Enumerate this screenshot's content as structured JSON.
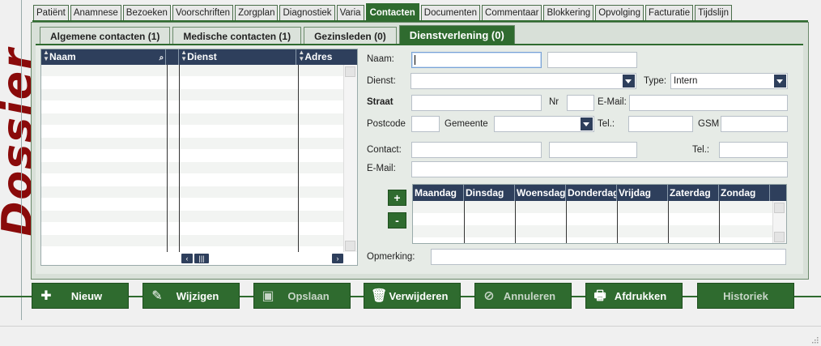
{
  "side_title": "Dossier",
  "top_tabs": [
    "Patiënt",
    "Anamnese",
    "Bezoeken",
    "Voorschriften",
    "Zorgplan",
    "Diagnostiek",
    "Varia",
    "Contacten",
    "Documenten",
    "Commentaar",
    "Blokkering",
    "Opvolging",
    "Facturatie",
    "Tijdslijn"
  ],
  "top_tab_active": "Contacten",
  "sub_tabs": [
    "Algemene contacten (1)",
    "Medische contacten (1)",
    "Gezinsleden (0)",
    "Dienstverlening (0)"
  ],
  "sub_tab_active": "Dienstverlening (0)",
  "list_grid": {
    "columns": [
      "Naam",
      "Dienst",
      "Adres"
    ]
  },
  "form": {
    "naam_label": "Naam:",
    "dienst_label": "Dienst:",
    "type_label": "Type:",
    "type_value": "Intern",
    "straat_label": "Straat",
    "nr_label": "Nr",
    "email_label_1": "E-Mail:",
    "postcode_label": "Postcode",
    "gemeente_label": "Gemeente",
    "tel_label_1": "Tel.:",
    "gsm_label": "GSM",
    "contact_label": "Contact:",
    "tel_label_2": "Tel.:",
    "email_label_2": "E-Mail:",
    "opmerking_label": "Opmerking:"
  },
  "schedule": {
    "add_symbol": "+",
    "remove_symbol": "-",
    "days": [
      "Maandag",
      "Dinsdag",
      "Woensdag",
      "Donderdag",
      "Vrijdag",
      "Zaterdag",
      "Zondag"
    ]
  },
  "actions": [
    {
      "label": "Nieuw",
      "icon": "plus-icon",
      "enabled": true
    },
    {
      "label": "Wijzigen",
      "icon": "pencil-icon",
      "enabled": true
    },
    {
      "label": "Opslaan",
      "icon": "save-icon",
      "enabled": false
    },
    {
      "label": "Verwijderen",
      "icon": "trash-icon",
      "enabled": true
    },
    {
      "label": "Annuleren",
      "icon": "cancel-icon",
      "enabled": false
    },
    {
      "label": "Afdrukken",
      "icon": "printer-icon",
      "enabled": true
    },
    {
      "label": "Historiek",
      "icon": "",
      "enabled": false
    }
  ],
  "colors": {
    "accent_green": "#2f6b2f",
    "header_navy": "#2e3f5c",
    "title_red": "#8a0a0a"
  }
}
